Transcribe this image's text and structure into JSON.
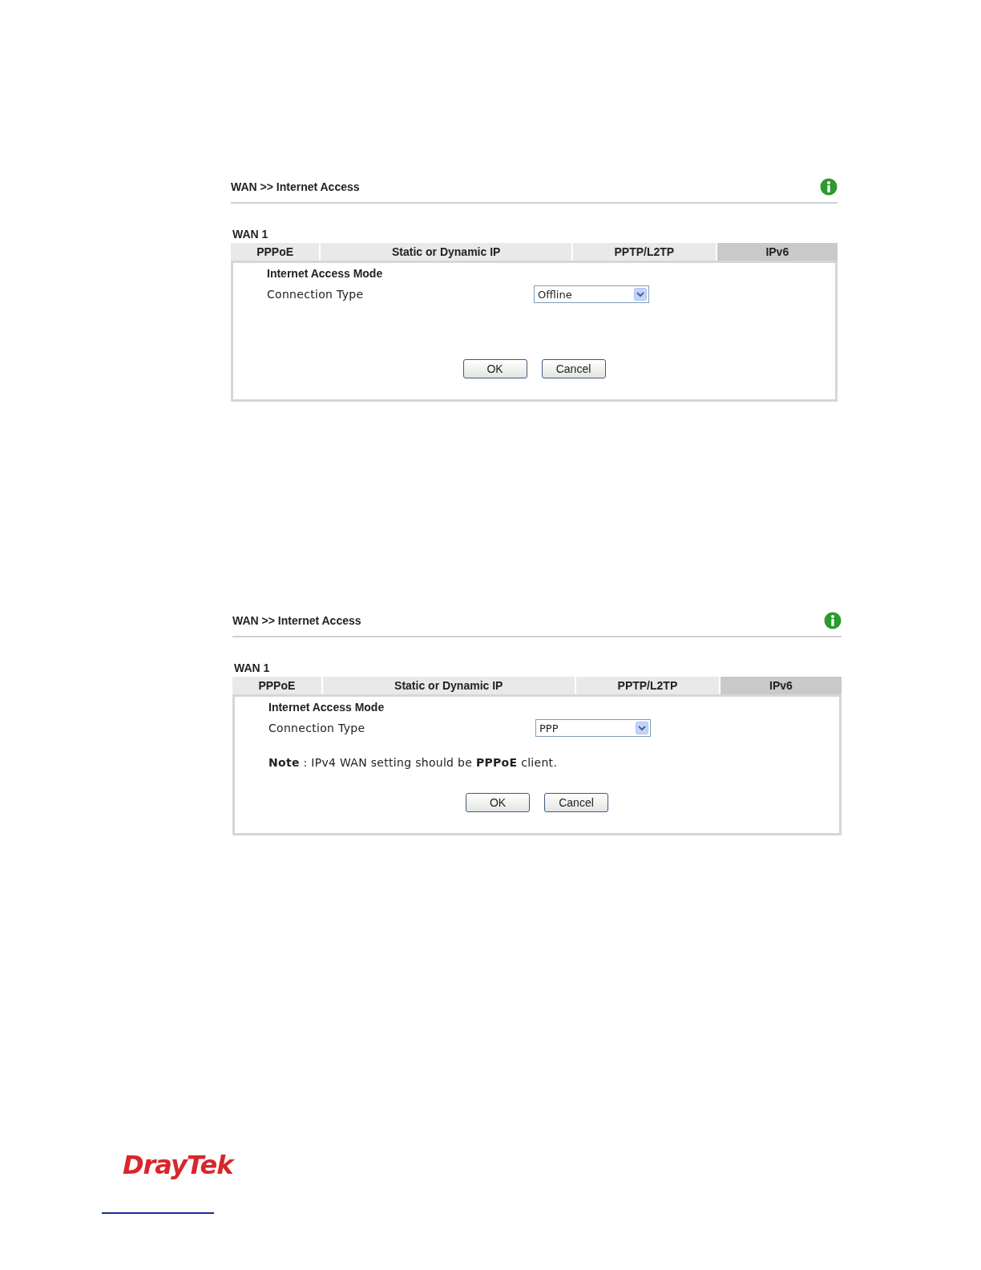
{
  "panels": [
    {
      "breadcrumb": "WAN >> Internet Access",
      "section": "WAN 1",
      "tabs": [
        {
          "label": "PPPoE",
          "selected": false
        },
        {
          "label": "Static or Dynamic IP",
          "selected": false
        },
        {
          "label": "PPTP/L2TP",
          "selected": false
        },
        {
          "label": "IPv6",
          "selected": true
        }
      ],
      "mode_heading": "Internet Access Mode",
      "field_label": "Connection Type",
      "connection_type": "Offline",
      "buttons": [
        "OK",
        "Cancel"
      ]
    },
    {
      "breadcrumb": "WAN >> Internet Access",
      "section": "WAN 1",
      "tabs": [
        {
          "label": "PPPoE",
          "selected": false
        },
        {
          "label": "Static or Dynamic IP",
          "selected": false
        },
        {
          "label": "PPTP/L2TP",
          "selected": false
        },
        {
          "label": "IPv6",
          "selected": true
        }
      ],
      "mode_heading": "Internet Access Mode",
      "field_label": "Connection Type",
      "connection_type": "PPP",
      "note": "**Note** : IPv4 WAN setting should be **PPPoE** client.",
      "buttons": [
        "OK",
        "Cancel"
      ]
    }
  ],
  "footer": {
    "logo": "DrayTek"
  }
}
